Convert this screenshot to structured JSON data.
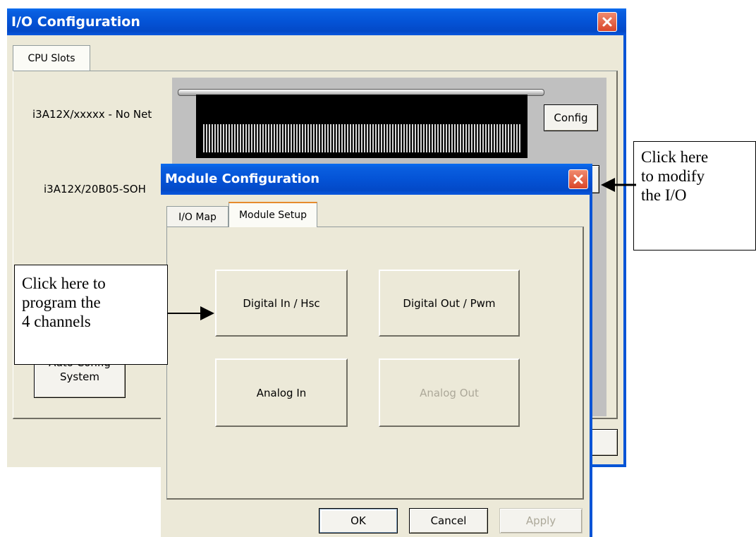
{
  "io_window": {
    "title": "I/O Configuration",
    "tabs": [
      "CPU Slots"
    ],
    "slots": [
      {
        "label": "i3A12X/xxxxx - No Net",
        "button": "Config"
      },
      {
        "label": "i3A12X/20B05-SOH"
      }
    ],
    "auto_config_button": [
      "Auto Config",
      "System"
    ]
  },
  "module_dialog": {
    "title": "Module Configuration",
    "tabs": [
      "I/O Map",
      "Module Setup"
    ],
    "active_tab": "Module Setup",
    "setup_buttons": {
      "digital_in": "Digital In / Hsc",
      "digital_out": "Digital Out / Pwm",
      "analog_in": "Analog In",
      "analog_out": "Analog Out"
    },
    "footer": {
      "ok": "OK",
      "cancel": "Cancel",
      "apply": "Apply"
    }
  },
  "callouts": {
    "modify_io": [
      "Click here",
      "to modify",
      "the I/O"
    ],
    "program_channels": [
      "Click here to",
      "program the",
      "4 channels"
    ]
  },
  "colors": {
    "titlebar": "#0453d6",
    "frame": "#ece9d8",
    "close_button": "#e0502e"
  }
}
